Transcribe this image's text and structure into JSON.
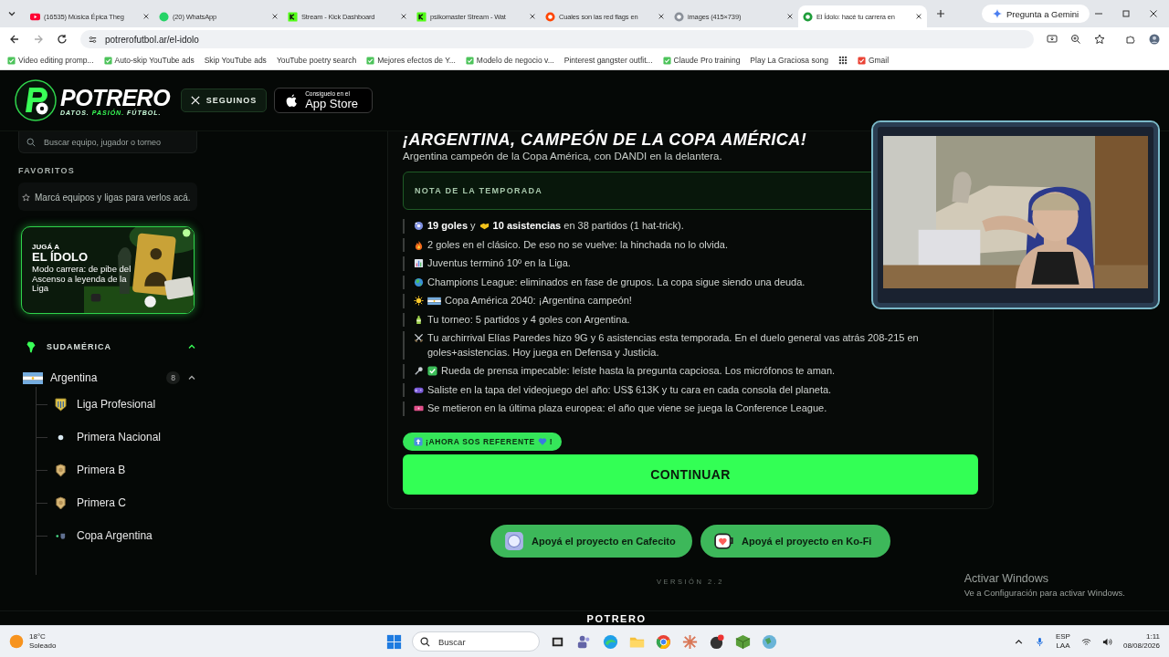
{
  "browser": {
    "tabs": [
      {
        "title": "(16535) Música Épica Theg",
        "selected": false
      },
      {
        "title": "(20) WhatsApp",
        "selected": false
      },
      {
        "title": "Stream - Kick Dashboard",
        "selected": false
      },
      {
        "title": "psikomaster Stream - Wat",
        "selected": false
      },
      {
        "title": "Cuales son las red flags en",
        "selected": false
      },
      {
        "title": "images (415×739)",
        "selected": false
      },
      {
        "title": "El Ídolo: hacé tu carrera en",
        "selected": true
      }
    ],
    "gemini_button": "Pregunta a Gemini",
    "url": "potrerofutbol.ar/el-idolo",
    "bookmarks": [
      {
        "label": "Video editing promp...",
        "favicon": true
      },
      {
        "label": "Auto-skip YouTube ads",
        "favicon": true
      },
      {
        "label": "Skip YouTube ads",
        "favicon": false
      },
      {
        "label": "YouTube poetry search",
        "favicon": false
      },
      {
        "label": "Mejores efectos de Y...",
        "favicon": true
      },
      {
        "label": "Modelo de negocio v...",
        "favicon": true
      },
      {
        "label": "Pinterest gangster outfit...",
        "favicon": false
      },
      {
        "label": "Claude Pro training",
        "favicon": true
      },
      {
        "label": "Play La Graciosa song",
        "favicon": false
      },
      {
        "label": "Gmail",
        "favicon": true
      }
    ]
  },
  "site": {
    "logo": "POTRERO",
    "tagline": [
      {
        "text": "DATOS.",
        "accent": false
      },
      {
        "text": "PASIÓN.",
        "accent": true
      },
      {
        "text": "FÚTBOL.",
        "accent": false
      }
    ],
    "follow_button": "SEGUINOS",
    "app_store": {
      "caption": "Consíguelo en el",
      "label": "App Store"
    }
  },
  "sidebar": {
    "search": {
      "placeholder": "Buscar equipo, jugador o torneo"
    },
    "favorites": {
      "title": "FAVORITOS",
      "empty_text": "Marcá equipos y ligas para verlos acá."
    },
    "promo": {
      "kicker": "JUGÁ A",
      "title": "EL ÍDOLO",
      "text": "Modo carrera: de pibe del Ascenso a leyenda de la Liga"
    },
    "regions": [
      {
        "label": "SUDAMÉRICA",
        "expanded": true,
        "countries": [
          {
            "name": "Argentina",
            "count": "8",
            "expanded": true,
            "children": [
              {
                "label": "Liga Profesional"
              },
              {
                "label": "Primera Nacional"
              },
              {
                "label": "Primera B"
              },
              {
                "label": "Primera C"
              },
              {
                "label": "Copa Argentina"
              }
            ]
          }
        ]
      }
    ]
  },
  "main": {
    "title": "¡ARGENTINA, CAMPEÓN DE LA COPA AMÉRICA!",
    "subtitle": "Argentina campeón de la Copa América, con DANDI en la delantera.",
    "note_title": "NOTA DE LA TEMPORADA",
    "notes": [
      {
        "parts": [
          "**19 goles** y",
          "**10 asistencias** en 38 partidos (1 hat-trick)."
        ]
      },
      {
        "parts": [
          "2 goles en el clásico. De eso no se vuelve: la hinchada no lo olvida."
        ]
      },
      {
        "parts": [
          "Juventus terminó 10º en la Liga."
        ]
      },
      {
        "parts": [
          "Champions League: eliminados en fase de grupos. La copa sigue siendo una deuda."
        ]
      },
      {
        "parts": [
          "Copa América 2040: ¡Argentina campeón!"
        ]
      },
      {
        "parts": [
          "Tu torneo: 5 partidos y 4 goles con Argentina."
        ]
      },
      {
        "parts": [
          "Tu archirrival Elías Paredes hizo 9G y 6 asistencias esta temporada. En el duelo general vas atrás 208-215 en goles+asistencias. Hoy juega en Defensa y Justicia."
        ]
      },
      {
        "parts": [
          "Rueda de prensa impecable: leíste hasta la pregunta capciosa. Los micrófonos te aman."
        ]
      },
      {
        "parts": [
          "Saliste en la tapa del videojuego del año: US$ 613K y tu cara en cada consola del planeta."
        ]
      },
      {
        "parts": [
          "Se metieron en la última plaza europea: el año que viene se juega la Conference League."
        ]
      }
    ],
    "badge": {
      "parts": [
        "¡AHORA SOS REFERENTE",
        "!"
      ]
    },
    "continue_button": "CONTINUAR",
    "support_buttons": [
      "Apoyá el proyecto en Cafecito",
      "Apoyá el proyecto en Ko-Fi"
    ],
    "version": "VERSIÓN 2.2",
    "footer_logo": "POTRERO"
  },
  "windows_notice": {
    "title": "Activar Windows",
    "text": "Ve a Configuración para activar Windows."
  },
  "taskbar": {
    "weather": {
      "temp": "18°C",
      "condition": "Soleado"
    },
    "search": {
      "placeholder": "Buscar"
    },
    "language": "ESP",
    "layout": "LAA",
    "time": "1:11",
    "date": "08/08/2026"
  }
}
